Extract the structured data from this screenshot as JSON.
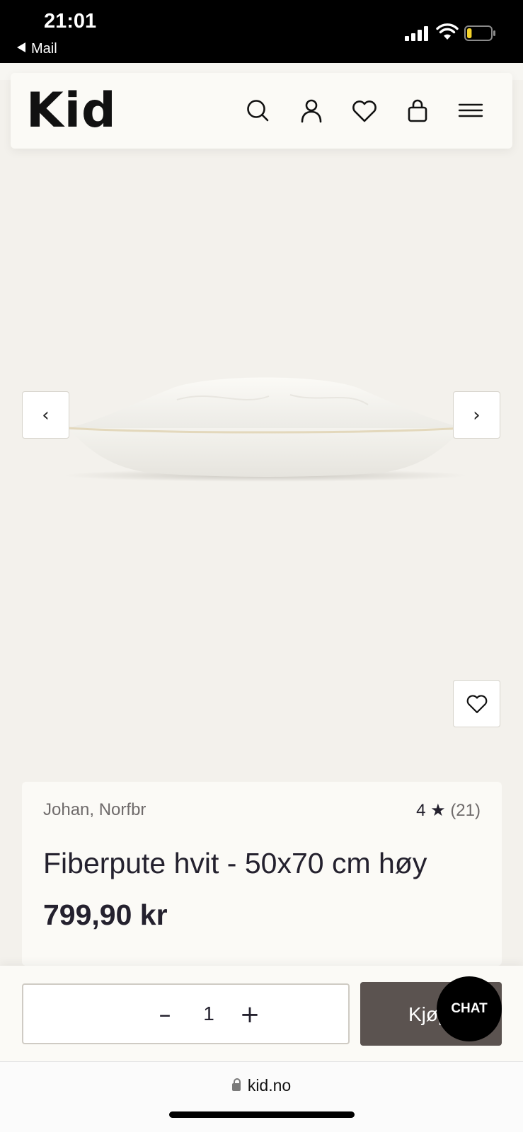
{
  "status_bar": {
    "time": "21:01",
    "back_label": "Mail",
    "icons": [
      "signal-icon",
      "wifi-icon",
      "battery-icon"
    ],
    "battery_level": 0.2,
    "battery_color": "#f4d22a"
  },
  "header": {
    "logo": "Kid",
    "icons": [
      "search-icon",
      "account-icon",
      "wishlist-icon",
      "cart-icon",
      "menu-icon"
    ]
  },
  "gallery": {
    "prev_label": "‹",
    "next_label": "›",
    "favorite_icon": "heart-icon"
  },
  "product": {
    "brand": "Johan, Norfbr",
    "rating": "4",
    "rating_star": "★",
    "review_count": "(21)",
    "title": "Fiberpute hvit - 50x70 cm høy",
    "price": "799,90 kr"
  },
  "purchase": {
    "qty_minus": "–",
    "qty_value": "1",
    "qty_plus": "+",
    "buy_label": "Kjøp",
    "buy_color": "#5b5350"
  },
  "chat": {
    "label": "CHAT"
  },
  "browser": {
    "url": "kid.no"
  },
  "colors": {
    "background": "#f3f1ec",
    "card": "#fbfaf6",
    "text": "#24212e"
  }
}
